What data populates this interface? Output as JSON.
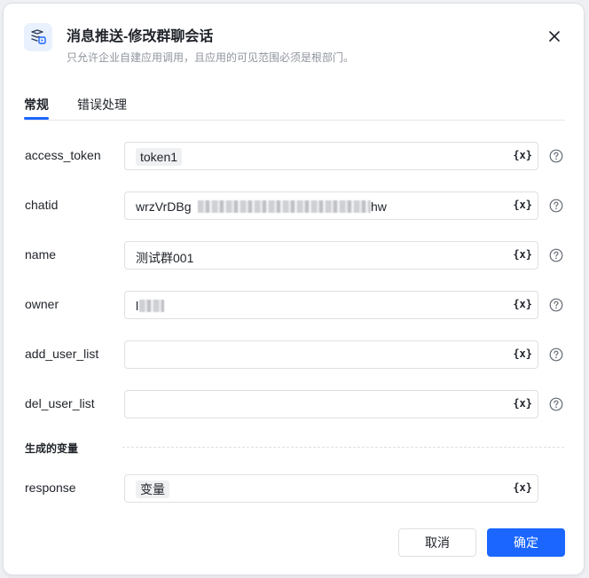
{
  "dialog": {
    "title": "消息推送-修改群聊会话",
    "subtitle": "只允许企业自建应用调用，且应用的可见范围必须是根部门。",
    "icon": "message-push-icon",
    "accent_color": "#1a66ff"
  },
  "tabs": [
    {
      "label": "常规",
      "active": true
    },
    {
      "label": "错误处理",
      "active": false
    }
  ],
  "fields": [
    {
      "label": "access_token",
      "chip": "token1",
      "value": ""
    },
    {
      "label": "chatid",
      "value_prefix": "wrzVrDBg",
      "value_suffix": "hw"
    },
    {
      "label": "name",
      "value": "测试群001"
    },
    {
      "label": "owner",
      "value": "l"
    },
    {
      "label": "add_user_list",
      "value": ""
    },
    {
      "label": "del_user_list",
      "value": ""
    }
  ],
  "variable_button": "{x}",
  "generated_section": {
    "title": "生成的变量",
    "label": "response",
    "chip": "变量"
  },
  "buttons": {
    "cancel": "取消",
    "ok": "确定"
  }
}
